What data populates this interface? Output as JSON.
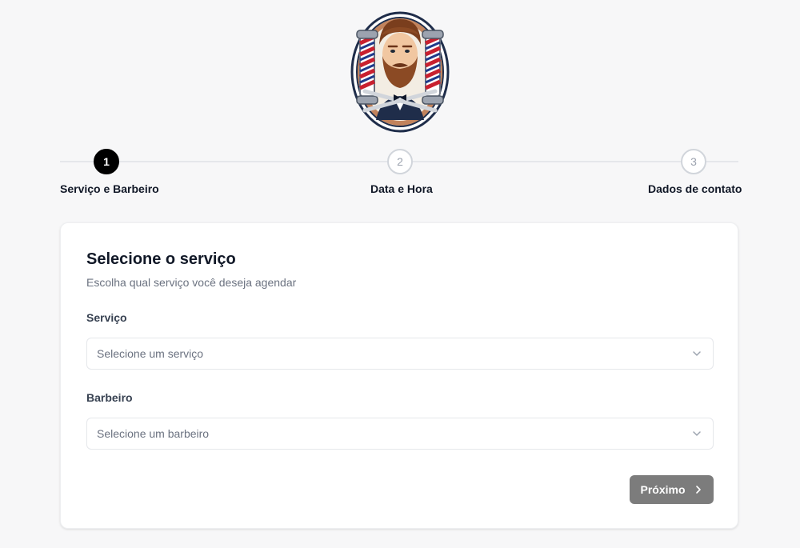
{
  "logo": {
    "alt": "barber-logo"
  },
  "stepper": {
    "steps": [
      {
        "number": "1",
        "label": "Serviço e Barbeiro",
        "active": true
      },
      {
        "number": "2",
        "label": "Data e Hora",
        "active": false
      },
      {
        "number": "3",
        "label": "Dados de contato",
        "active": false
      }
    ]
  },
  "card": {
    "title": "Selecione o serviço",
    "subtitle": "Escolha qual serviço você deseja agendar",
    "service": {
      "label": "Serviço",
      "placeholder": "Selecione um serviço"
    },
    "barber": {
      "label": "Barbeiro",
      "placeholder": "Selecione um barbeiro"
    },
    "next_label": "Próximo"
  },
  "colors": {
    "accent": "#000000",
    "button_disabled": "#7c7c7c",
    "background": "#f7f7f8"
  }
}
